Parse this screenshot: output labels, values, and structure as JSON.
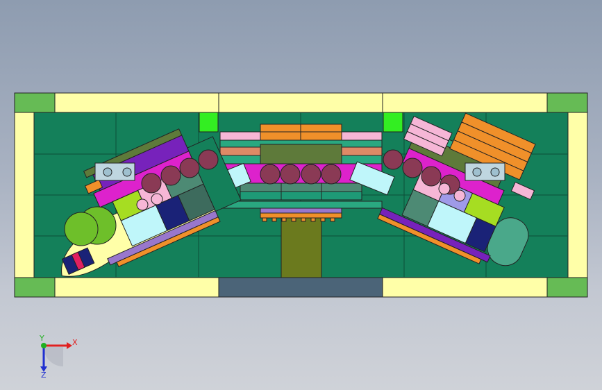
{
  "viewport": {
    "background_top": "#8e9cb0",
    "background_bottom": "#cfd2d8"
  },
  "model": {
    "plate_color": "#14805a",
    "frame_color": "#ffffa8",
    "corner_color": "#66bb55",
    "outline_color": "#222222",
    "accent_colors": {
      "orange": "#f0902a",
      "pink": "#f6b6d6",
      "magenta": "#dd22cc",
      "cyan": "#bff6fa",
      "roller": "#8a3a55",
      "lime": "#a6dd22",
      "olive": "#6b7a1e",
      "purple": "#7722bb",
      "navy": "#1a2277",
      "slate": "#4d6d7d"
    }
  },
  "triad": {
    "x_label": "X",
    "y_label": "Y",
    "z_label": "Z",
    "x_color": "#e02020",
    "y_color": "#20b020",
    "z_color": "#2030d0"
  }
}
